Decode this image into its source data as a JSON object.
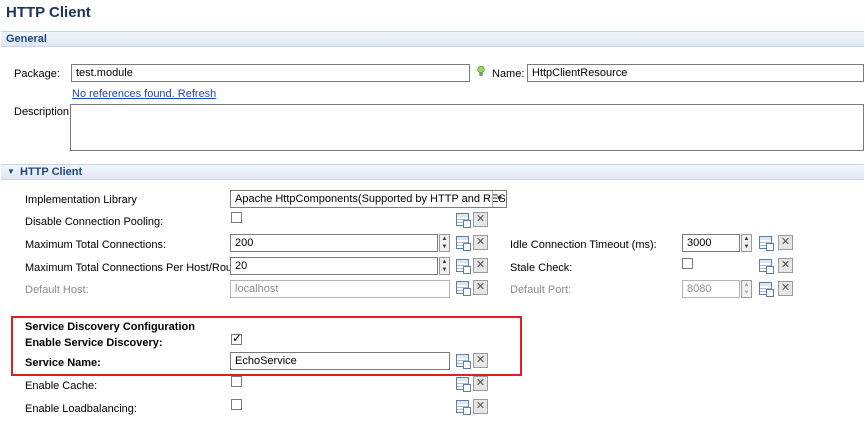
{
  "header": {
    "title": "HTTP Client"
  },
  "general": {
    "section_title": "General",
    "package_label": "Package:",
    "package_value": "test.module",
    "name_label": "Name:",
    "name_value": "HttpClientResource",
    "references_link": "No references found. Refresh",
    "description_label": "Description:"
  },
  "http_client": {
    "section_title": "HTTP Client",
    "collapse_icon": "triangle-down-icon",
    "implementation_library": {
      "label": "Implementation Library",
      "value": "Apache HttpComponents(Supported by HTTP and REST)"
    },
    "disable_connection_pooling": {
      "label": "Disable Connection Pooling:",
      "checked": false
    },
    "max_total_connections": {
      "label": "Maximum Total Connections:",
      "value": "200"
    },
    "max_per_host": {
      "label": "Maximum Total Connections Per Host/Route:",
      "value": "20"
    },
    "default_host": {
      "label": "Default Host:",
      "value": "localhost"
    },
    "idle_timeout": {
      "label": "Idle Connection Timeout (ms):",
      "value": "3000"
    },
    "stale_check": {
      "label": "Stale Check:",
      "checked": false
    },
    "default_port": {
      "label": "Default Port:",
      "value": "8080"
    },
    "service_discovery": {
      "heading": "Service Discovery Configuration",
      "enable_label": "Enable Service Discovery:",
      "enable_checked": true,
      "service_name_label": "Service Name:",
      "service_name_value": "EchoService"
    },
    "enable_cache": {
      "label": "Enable Cache:",
      "checked": false
    },
    "enable_loadbalancing": {
      "label": "Enable Loadbalancing:",
      "checked": false
    }
  },
  "colors": {
    "section_title": "#20467f",
    "highlight_border": "#e02020",
    "link": "#1a47c4"
  }
}
